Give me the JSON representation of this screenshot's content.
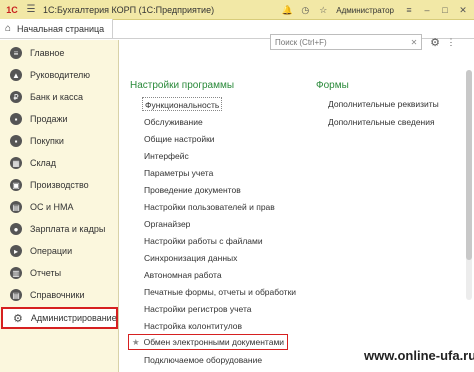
{
  "window": {
    "title": "1С:Бухгалтерия КОРП  (1С:Предприятие)",
    "logo_text": "1С",
    "user": "Администратор"
  },
  "tabs": {
    "home": "Начальная страница"
  },
  "sidebar": {
    "items": [
      {
        "label": "Главное",
        "icon": "menu-icon"
      },
      {
        "label": "Руководителю",
        "icon": "chart-icon"
      },
      {
        "label": "Банк и касса",
        "icon": "bank-icon"
      },
      {
        "label": "Продажи",
        "icon": "sales-icon"
      },
      {
        "label": "Покупки",
        "icon": "purchases-icon"
      },
      {
        "label": "Склад",
        "icon": "warehouse-icon"
      },
      {
        "label": "Производство",
        "icon": "factory-icon"
      },
      {
        "label": "ОС и НМА",
        "icon": "assets-icon"
      },
      {
        "label": "Зарплата и кадры",
        "icon": "people-icon"
      },
      {
        "label": "Операции",
        "icon": "operations-icon"
      },
      {
        "label": "Отчеты",
        "icon": "reports-icon"
      },
      {
        "label": "Справочники",
        "icon": "catalogs-icon"
      },
      {
        "label": "Администрирование",
        "icon": "gear-icon"
      }
    ],
    "active_index": 12
  },
  "search": {
    "placeholder": "Поиск (Ctrl+F)"
  },
  "settings": {
    "title": "Настройки программы",
    "items": [
      "Функциональность",
      "Обслуживание",
      "Общие настройки",
      "Интерфейс",
      "Параметры учета",
      "Проведение документов",
      "Настройки пользователей и прав",
      "Органайзер",
      "Настройки работы с файлами",
      "Синхронизация данных",
      "Автономная работа",
      "Печатные формы, отчеты и обработки",
      "Настройки регистров учета",
      "Настройка колонтитулов",
      "Обмен электронными документами",
      "Подключаемое оборудование"
    ],
    "highlighted_index": 14
  },
  "forms": {
    "title": "Формы",
    "items": [
      "Дополнительные реквизиты",
      "Дополнительные сведения"
    ]
  },
  "watermark": "www.online-ufa.ru",
  "colors": {
    "titlebar": "#f2e8a6",
    "sidebar": "#fbf7dd",
    "section_title": "#2a8a3a",
    "highlight": "#d62020"
  }
}
